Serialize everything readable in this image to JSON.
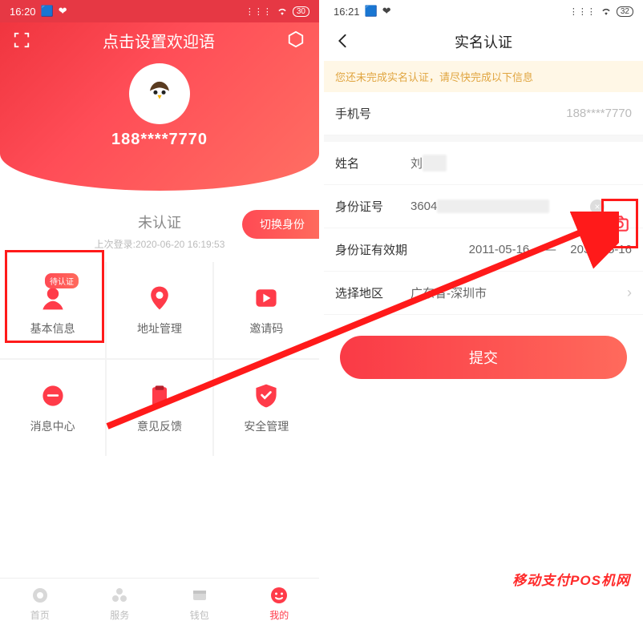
{
  "left": {
    "statusbar": {
      "time": "16:20",
      "battery": "30"
    },
    "header": {
      "welcome_text": "点击设置欢迎语",
      "phone_masked": "188****7770"
    },
    "status": {
      "auth_state": "未认证",
      "last_login_prefix": "上次登录:",
      "last_login_value": "2020-06-20 16:19:53",
      "switch_identity": "切换身份"
    },
    "tiles": [
      {
        "label": "基本信息",
        "badge": "待认证"
      },
      {
        "label": "地址管理"
      },
      {
        "label": "邀请码"
      },
      {
        "label": "消息中心"
      },
      {
        "label": "意见反馈"
      },
      {
        "label": "安全管理"
      }
    ],
    "nav": {
      "items": [
        {
          "label": "首页"
        },
        {
          "label": "服务"
        },
        {
          "label": "钱包"
        },
        {
          "label": "我的"
        }
      ],
      "active_index": 3
    }
  },
  "right": {
    "statusbar": {
      "time": "16:21",
      "battery": "32"
    },
    "title": "实名认证",
    "notice": "您还未完成实名认证，请尽快完成以下信息",
    "rows": {
      "phone_label": "手机号",
      "phone_value": "188****7770",
      "name_label": "姓名",
      "name_value_visible": "刘",
      "id_label": "身份证号",
      "id_value_visible": "3604",
      "validity_label": "身份证有效期",
      "validity_start": "2011-05-16",
      "validity_sep": "—",
      "validity_end": "2031-05-16",
      "region_label": "选择地区",
      "region_value": "广东省-深圳市"
    },
    "submit_label": "提交"
  },
  "watermark": "移动支付POS机网",
  "colors": {
    "brand_red": "#ff3b49",
    "brand_orange": "#ff6a5c",
    "annot_red": "#ff1a1a",
    "notice_bg": "#fff7e6",
    "notice_fg": "#e0a540"
  }
}
